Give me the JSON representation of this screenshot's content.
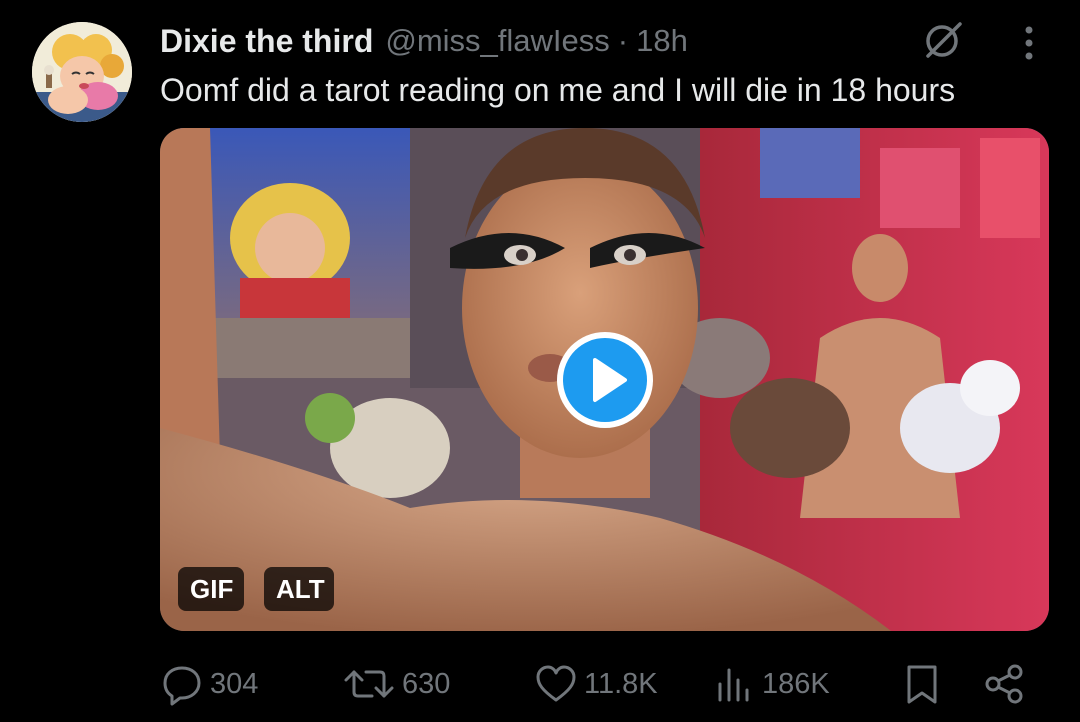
{
  "tweet": {
    "display_name": "Dixie the third",
    "handle": "@miss_flawIess",
    "separator": "·",
    "time": "18h",
    "text": "Oomf did a tarot reading on me and I will die in 18 hours"
  },
  "media": {
    "badges": {
      "gif": "GIF",
      "alt": "ALT"
    },
    "play_color": "#1d9bf0"
  },
  "actions": {
    "replies": "304",
    "reposts": "630",
    "likes": "11.8K",
    "views": "186K"
  },
  "colors": {
    "background": "#000000",
    "primary_text": "#e7e9ea",
    "secondary_text": "#71767b",
    "accent": "#1d9bf0"
  }
}
